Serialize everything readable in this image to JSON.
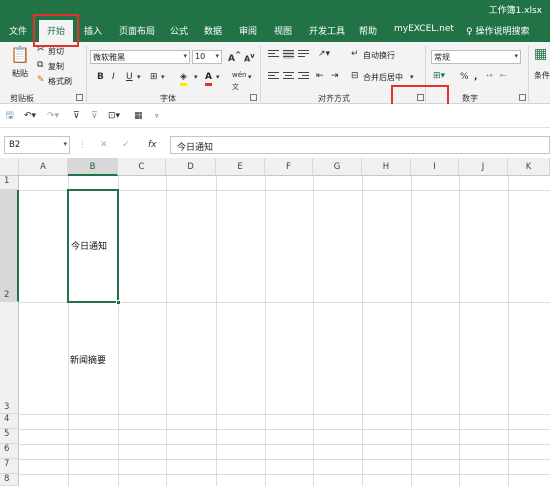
{
  "window": {
    "title": "工作簿1.xlsx"
  },
  "tabs": [
    "文件",
    "开始",
    "插入",
    "页面布局",
    "公式",
    "数据",
    "审阅",
    "视图",
    "开发工具",
    "帮助",
    "myEXCEL.net"
  ],
  "tell_me": "操作说明搜索",
  "ribbon": {
    "clipboard": {
      "paste": "粘贴",
      "cut": "剪切",
      "copy": "复制",
      "format_painter": "格式刷",
      "label": "剪贴板"
    },
    "font": {
      "name": "微软雅黑",
      "size": "10",
      "label": "字体",
      "increase": "A",
      "decrease": "A",
      "bold": "B",
      "italic": "I",
      "underline": "U",
      "wen": "wén"
    },
    "alignment": {
      "wrap": "自动换行",
      "merge": "合并后居中",
      "label": "对齐方式"
    },
    "number": {
      "format": "常规",
      "percent": "%",
      "comma": ",",
      "label": "数字"
    },
    "styles": {
      "label": "条件"
    }
  },
  "formula_bar": {
    "name_box": "B2",
    "fx": "fx",
    "value": "今日通知"
  },
  "columns": [
    "A",
    "B",
    "C",
    "D",
    "E",
    "F",
    "G",
    "H",
    "I",
    "J",
    "K"
  ],
  "rows": [
    "1",
    "2",
    "3",
    "4",
    "5",
    "6",
    "7",
    "8"
  ],
  "cells": {
    "b2": "今日通知",
    "b3": "新闻摘要"
  },
  "colors": {
    "accent": "#217346",
    "highlight": "#e0332f"
  }
}
